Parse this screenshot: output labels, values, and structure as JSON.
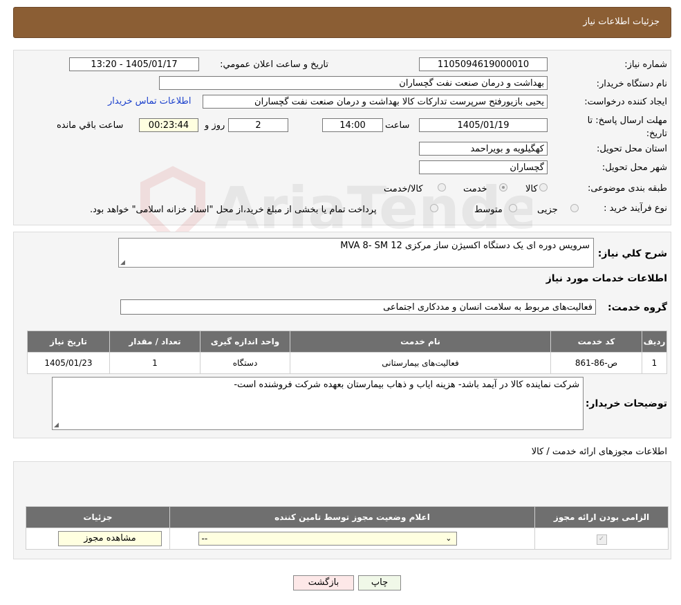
{
  "header": {
    "title": "جزئیات اطلاعات نیاز"
  },
  "fields": {
    "need_number_label": "شماره نیاز:",
    "need_number": "1105094619000010",
    "announce_label": "تاریخ و ساعت اعلان عمومي:",
    "announce_value": "1405/01/17 - 13:20",
    "buyer_org_label": "نام دستگاه خریدار:",
    "buyer_org": "بهداشت و درمان صنعت نفت گچساران",
    "requester_label": "ایجاد کننده درخواست:",
    "requester": "یحیی بازیورفتح سرپرست تدارکات کالا  بهداشت و درمان صنعت نفت گچساران",
    "contact_link": "اطلاعات تماس خریدار",
    "deadline_label": "مهلت ارسال پاسخ: تا تاریخ:",
    "deadline_date": "1405/01/19",
    "time_label": "ساعت",
    "deadline_time": "14:00",
    "days_value": "2",
    "days_label": "روز و",
    "remaining_value": "00:23:44",
    "remaining_label": "ساعت باقي مانده",
    "province_label": "استان محل تحویل:",
    "province": "کهگیلویه و بویراحمد",
    "city_label": "شهر محل تحویل:",
    "city": "گچساران",
    "category_label": "طبقه بندی موضوعی:",
    "category_options": [
      "کالا",
      "خدمت",
      "کالا/خدمت"
    ],
    "category_selected": "خدمت",
    "process_label": "نوع فرآیند خرید :",
    "process_options": [
      "جزیی",
      "متوسط"
    ],
    "process_note": "پرداخت تمام یا بخشی از مبلغ خرید،از محل \"اسناد خزانه اسلامی\" خواهد بود."
  },
  "summary": {
    "label": "شرح کلي نیاز:",
    "value": "سرویس دوره ای یک دستگاه اکسیژن ساز مرکزی MVA 8- SM 12"
  },
  "services": {
    "section_title": "اطلاعات خدمات مورد نیاز",
    "group_label": "گروه خدمت:",
    "group_value": "فعالیت‌های مربوط به سلامت انسان و مددکاری اجتماعی",
    "table": {
      "headers": [
        "ردیف",
        "کد خدمت",
        "نام خدمت",
        "واحد اندازه گیری",
        "تعداد / مقدار",
        "تاریخ نیاز"
      ],
      "rows": [
        [
          "1",
          "ص-86-861",
          "فعالیت‌های بیمارستانی",
          "دستگاه",
          "1",
          "1405/01/23"
        ]
      ]
    }
  },
  "buyer_notes": {
    "label": "توضیحات خریدار:",
    "value": "شرکت نماینده کالا در آیمد باشد- هزینه ایاب و ذهاب بیمارستان بعهده شرکت فروشنده است-"
  },
  "permits": {
    "section_title": "اطلاعات مجوزهای ارائه خدمت / کالا",
    "headers": [
      "الزامی بودن ارائه مجوز",
      "اعلام وضعیت مجوز توسط تامین کننده",
      "جزئیات"
    ],
    "select_value": "--",
    "view_button": "مشاهده مجوز"
  },
  "buttons": {
    "print": "چاپ",
    "back": "بازگشت"
  },
  "watermark": {
    "text": "AriaTender.neT"
  },
  "colors": {
    "header_bg": "#8b5e34",
    "table_header_bg": "#6f6f6f",
    "highlight_bg": "#ffffe0",
    "back_button_bg": "#fde8e8",
    "print_button_bg": "#f0f8e8",
    "link": "#1a3fcc"
  }
}
